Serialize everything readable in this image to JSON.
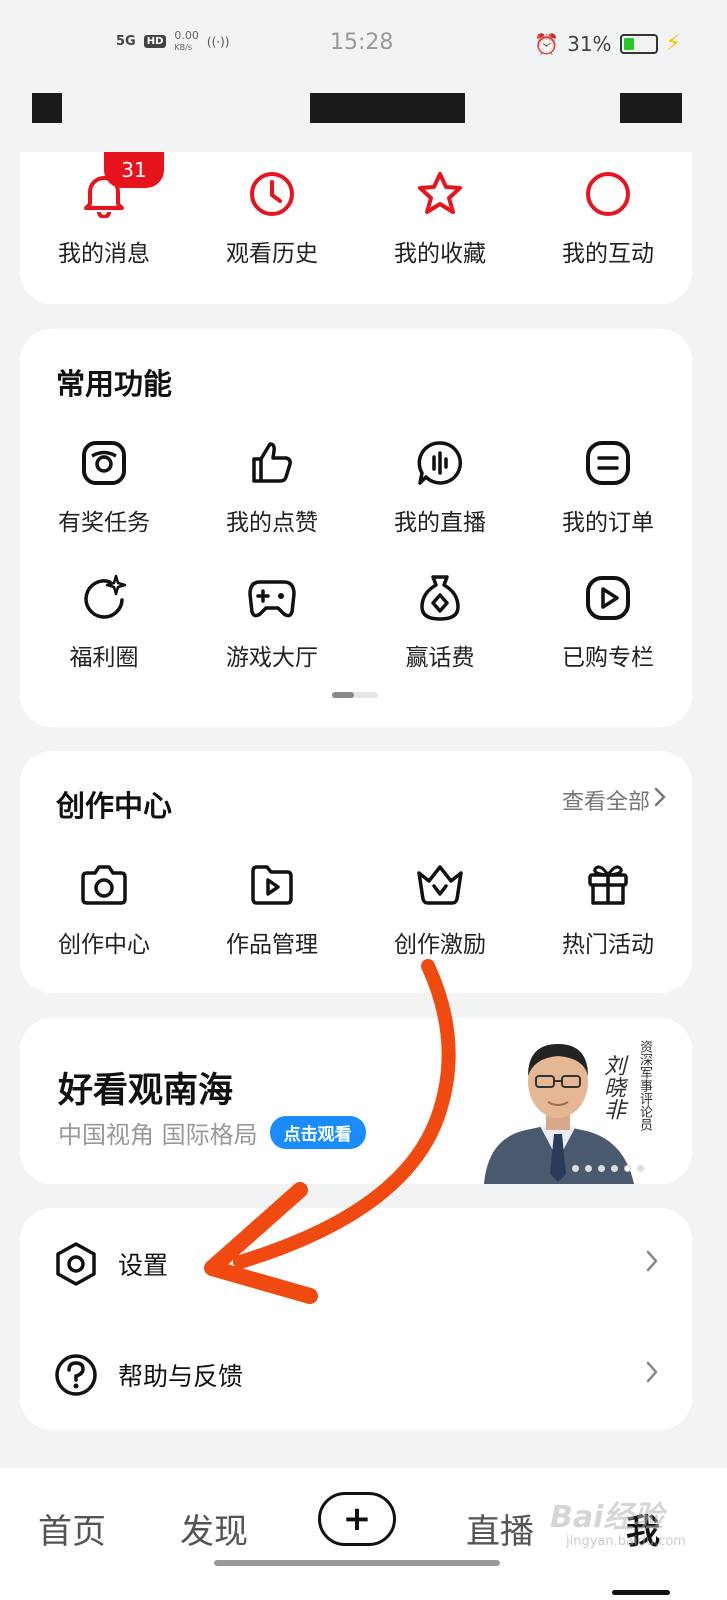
{
  "status_bar": {
    "signal": "5G",
    "hd": "HD",
    "speed": "0.00",
    "speed_unit": "KB/s",
    "time": "15:28",
    "battery": "31%",
    "battery_level": 0.31
  },
  "top_shortcuts": {
    "unread_badge": "31",
    "items": [
      {
        "label": "我的消息",
        "icon": "bell-icon"
      },
      {
        "label": "观看历史",
        "icon": "clock-icon"
      },
      {
        "label": "我的收藏",
        "icon": "star-icon"
      },
      {
        "label": "我的互动",
        "icon": "circle-icon"
      }
    ]
  },
  "common_functions": {
    "title": "常用功能",
    "items": [
      {
        "label": "有奖任务",
        "icon": "reward-task-icon"
      },
      {
        "label": "我的点赞",
        "icon": "thumbs-up-icon"
      },
      {
        "label": "我的直播",
        "icon": "live-icon"
      },
      {
        "label": "我的订单",
        "icon": "order-icon"
      },
      {
        "label": "福利圈",
        "icon": "welfare-icon"
      },
      {
        "label": "游戏大厅",
        "icon": "gamepad-icon"
      },
      {
        "label": "赢话费",
        "icon": "money-bag-icon"
      },
      {
        "label": "已购专栏",
        "icon": "purchased-column-icon"
      }
    ]
  },
  "creator_center": {
    "title": "创作中心",
    "see_all": "查看全部",
    "items": [
      {
        "label": "创作中心",
        "icon": "camera-icon"
      },
      {
        "label": "作品管理",
        "icon": "folder-play-icon"
      },
      {
        "label": "创作激励",
        "icon": "crown-icon"
      },
      {
        "label": "热门活动",
        "icon": "gift-icon"
      }
    ]
  },
  "promo": {
    "title": "好看观南海",
    "subtitle": "中国视角 国际格局",
    "button": "点击观看",
    "caption": "资深军事评论员",
    "name": "刘晓非"
  },
  "settings_list": {
    "items": [
      {
        "label": "设置",
        "icon": "settings-hex-icon"
      },
      {
        "label": "帮助与反馈",
        "icon": "help-icon"
      }
    ]
  },
  "bottom_nav": {
    "home": "首页",
    "discover": "发现",
    "add": "+",
    "live": "直播",
    "me": "我"
  },
  "watermark": {
    "text": "Bai经验",
    "sub": "jingyan.baidu.com"
  },
  "colors": {
    "accent_red": "#e8141d",
    "annotation_arrow": "#f04a10",
    "button_blue": "#1a8cff"
  }
}
